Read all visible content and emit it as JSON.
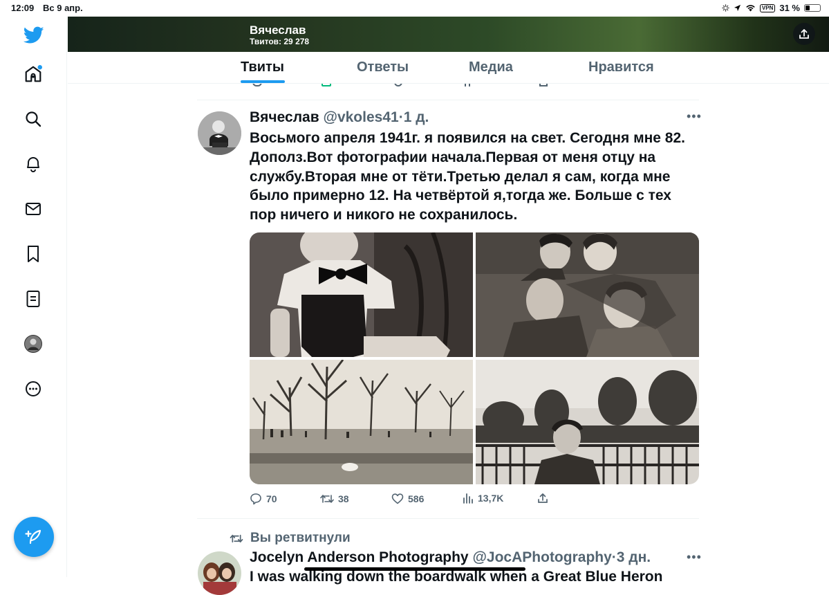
{
  "status_bar": {
    "time": "12:09",
    "date": "Вс 9 апр.",
    "vpn": "VPN",
    "battery": "31 %",
    "battery_level": 0.31
  },
  "sidebar": {
    "items": [
      {
        "name": "home-icon"
      },
      {
        "name": "search-icon"
      },
      {
        "name": "notifications-icon"
      },
      {
        "name": "messages-icon"
      },
      {
        "name": "bookmarks-icon"
      },
      {
        "name": "lists-icon"
      },
      {
        "name": "profile-avatar"
      },
      {
        "name": "more-icon"
      }
    ],
    "compose": "compose-tweet-icon"
  },
  "header": {
    "name": "Вячеслав",
    "tweet_count": "Твитов: 29 278"
  },
  "tabs": [
    {
      "label": "Твиты",
      "active": true
    },
    {
      "label": "Ответы",
      "active": false
    },
    {
      "label": "Медиа",
      "active": false
    },
    {
      "label": "Нравится",
      "active": false
    }
  ],
  "tweet": {
    "name": "Вячеслав",
    "handle": "@vkoles41",
    "separator": "·",
    "time": "1 д.",
    "text": "Восьмого апреля 1941г. я появился на свет. Сегодня мне 82. Дополз.Вот фотографии начала.Первая от меня отцу на службу.Вторая мне от тёти.Третью делал я сам, когда мне было примерно 12. На четвёртой я,тогда же. Больше с тех пор ничего и никого не сохранилось.",
    "photos": [
      {
        "name": "photo-child-bowtie"
      },
      {
        "name": "photo-women-group"
      },
      {
        "name": "photo-park-trees"
      },
      {
        "name": "photo-boy-fence"
      }
    ],
    "actions": {
      "replies": "70",
      "retweets": "38",
      "likes": "586",
      "views": "13,7K"
    }
  },
  "retweet_notice": "Вы ретвитнули",
  "tweet2": {
    "name": "Jocelyn Anderson Photography",
    "handle": "@JocAPhotography",
    "separator": "·",
    "time": "3 дн.",
    "text": "I was walking down the boardwalk when a Great Blue Heron"
  },
  "colors": {
    "accent": "#1d9bf0",
    "text": "#0f1419",
    "secondary": "#536471"
  }
}
